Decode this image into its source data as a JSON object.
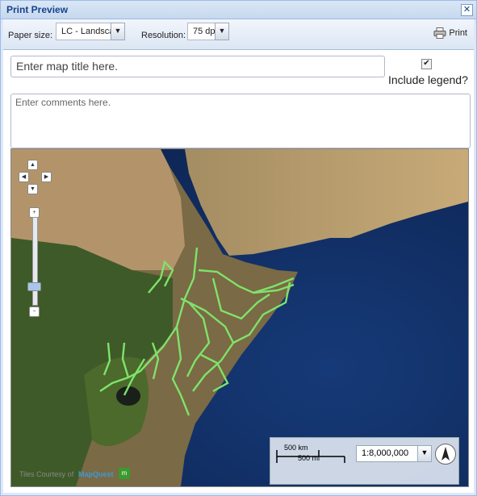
{
  "window": {
    "title": "Print Preview",
    "close_label": "✕"
  },
  "toolbar": {
    "paper_size_label": "Paper size:",
    "paper_size_value": "LC -  Landsca",
    "resolution_label": "Resolution:",
    "resolution_value": "75 dpi",
    "print_label": "Print"
  },
  "form": {
    "map_title_placeholder": "Enter map title here.",
    "include_legend_label": "Include legend?",
    "include_legend_checked": true,
    "comments_placeholder": "Enter comments here."
  },
  "map": {
    "scale_km": "500 km",
    "scale_mi": "500 mi",
    "scale_value": "1:8,000,000",
    "attribution": "Tiles Courtesy of",
    "provider": "MapQuest"
  },
  "icons": [
    "close-icon",
    "chevron-down-icon",
    "printer-icon",
    "pan-up-icon",
    "pan-down-icon",
    "pan-left-icon",
    "pan-right-icon",
    "zoom-in-icon",
    "zoom-out-icon",
    "north-arrow-icon"
  ]
}
